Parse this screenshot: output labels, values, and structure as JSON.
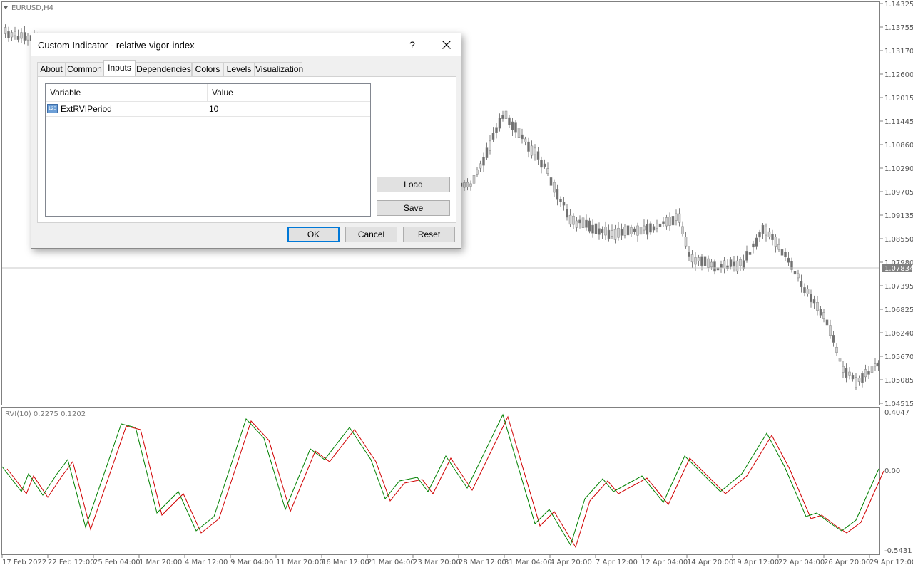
{
  "chart": {
    "symbol_label": "EURUSD,H4",
    "price_axis": [
      "1.14325",
      "1.13755",
      "1.13170",
      "1.12600",
      "1.12015",
      "1.11445",
      "1.10860",
      "1.10290",
      "1.09705",
      "1.09135",
      "1.08550",
      "1.07980",
      "1.07395",
      "1.06825",
      "1.06240",
      "1.05670",
      "1.05085",
      "1.04515"
    ],
    "current_price": "1.07834",
    "indicator_label": "RVI(10) 0.2275 0.1202",
    "indicator_axis": [
      "0.4047",
      "0.00",
      "-0.5431"
    ],
    "time_axis": [
      "17 Feb 2022",
      "22 Feb 12:00",
      "25 Feb 04:00",
      "1 Mar 20:00",
      "4 Mar 12:00",
      "9 Mar 04:00",
      "11 Mar 20:00",
      "16 Mar 12:00",
      "21 Mar 04:00",
      "23 Mar 20:00",
      "28 Mar 12:00",
      "31 Mar 04:00",
      "4 Apr 20:00",
      "7 Apr 12:00",
      "12 Apr 04:00",
      "14 Apr 20:00",
      "19 Apr 12:00",
      "22 Apr 04:00",
      "26 Apr 20:00",
      "29 Apr 12:00"
    ],
    "colors": {
      "rvi_main": "#008000",
      "rvi_signal": "#d00000",
      "candles": "#808080",
      "current_price_bg": "#808080"
    }
  },
  "dialog": {
    "title": "Custom Indicator - relative-vigor-index",
    "help_label": "?",
    "tabs": [
      "About",
      "Common",
      "Inputs",
      "Dependencies",
      "Colors",
      "Levels",
      "Visualization"
    ],
    "active_tab": "Inputs",
    "table": {
      "headers": [
        "Variable",
        "Value"
      ],
      "rows": [
        {
          "variable": "ExtRVIPeriod",
          "value": "10",
          "icon": "123"
        }
      ]
    },
    "load_label": "Load",
    "save_label": "Save",
    "ok_label": "OK",
    "cancel_label": "Cancel",
    "reset_label": "Reset"
  }
}
